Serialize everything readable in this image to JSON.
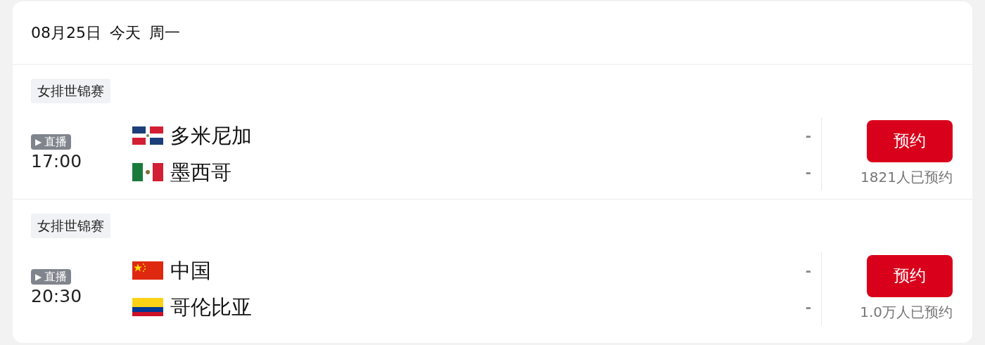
{
  "header": {
    "date": "08月25日",
    "day": "今天",
    "weekday": "周一"
  },
  "matches": [
    {
      "league": "女排世锦赛",
      "live_badge": {
        "icon": "▶",
        "label": "直播"
      },
      "time": "17:00",
      "teams": [
        {
          "name": "多米尼加",
          "score": "-"
        },
        {
          "name": "墨西哥",
          "score": "-"
        }
      ],
      "button": "预约",
      "count": "1821人已预约"
    },
    {
      "league": "女排世锦赛",
      "live_badge": {
        "icon": "▶",
        "label": "直播"
      },
      "time": "20:30",
      "teams": [
        {
          "name": "中国",
          "score": "-"
        },
        {
          "name": "哥伦比亚",
          "score": "-"
        }
      ],
      "button": "预约",
      "count": "1.0万人已预约"
    }
  ]
}
